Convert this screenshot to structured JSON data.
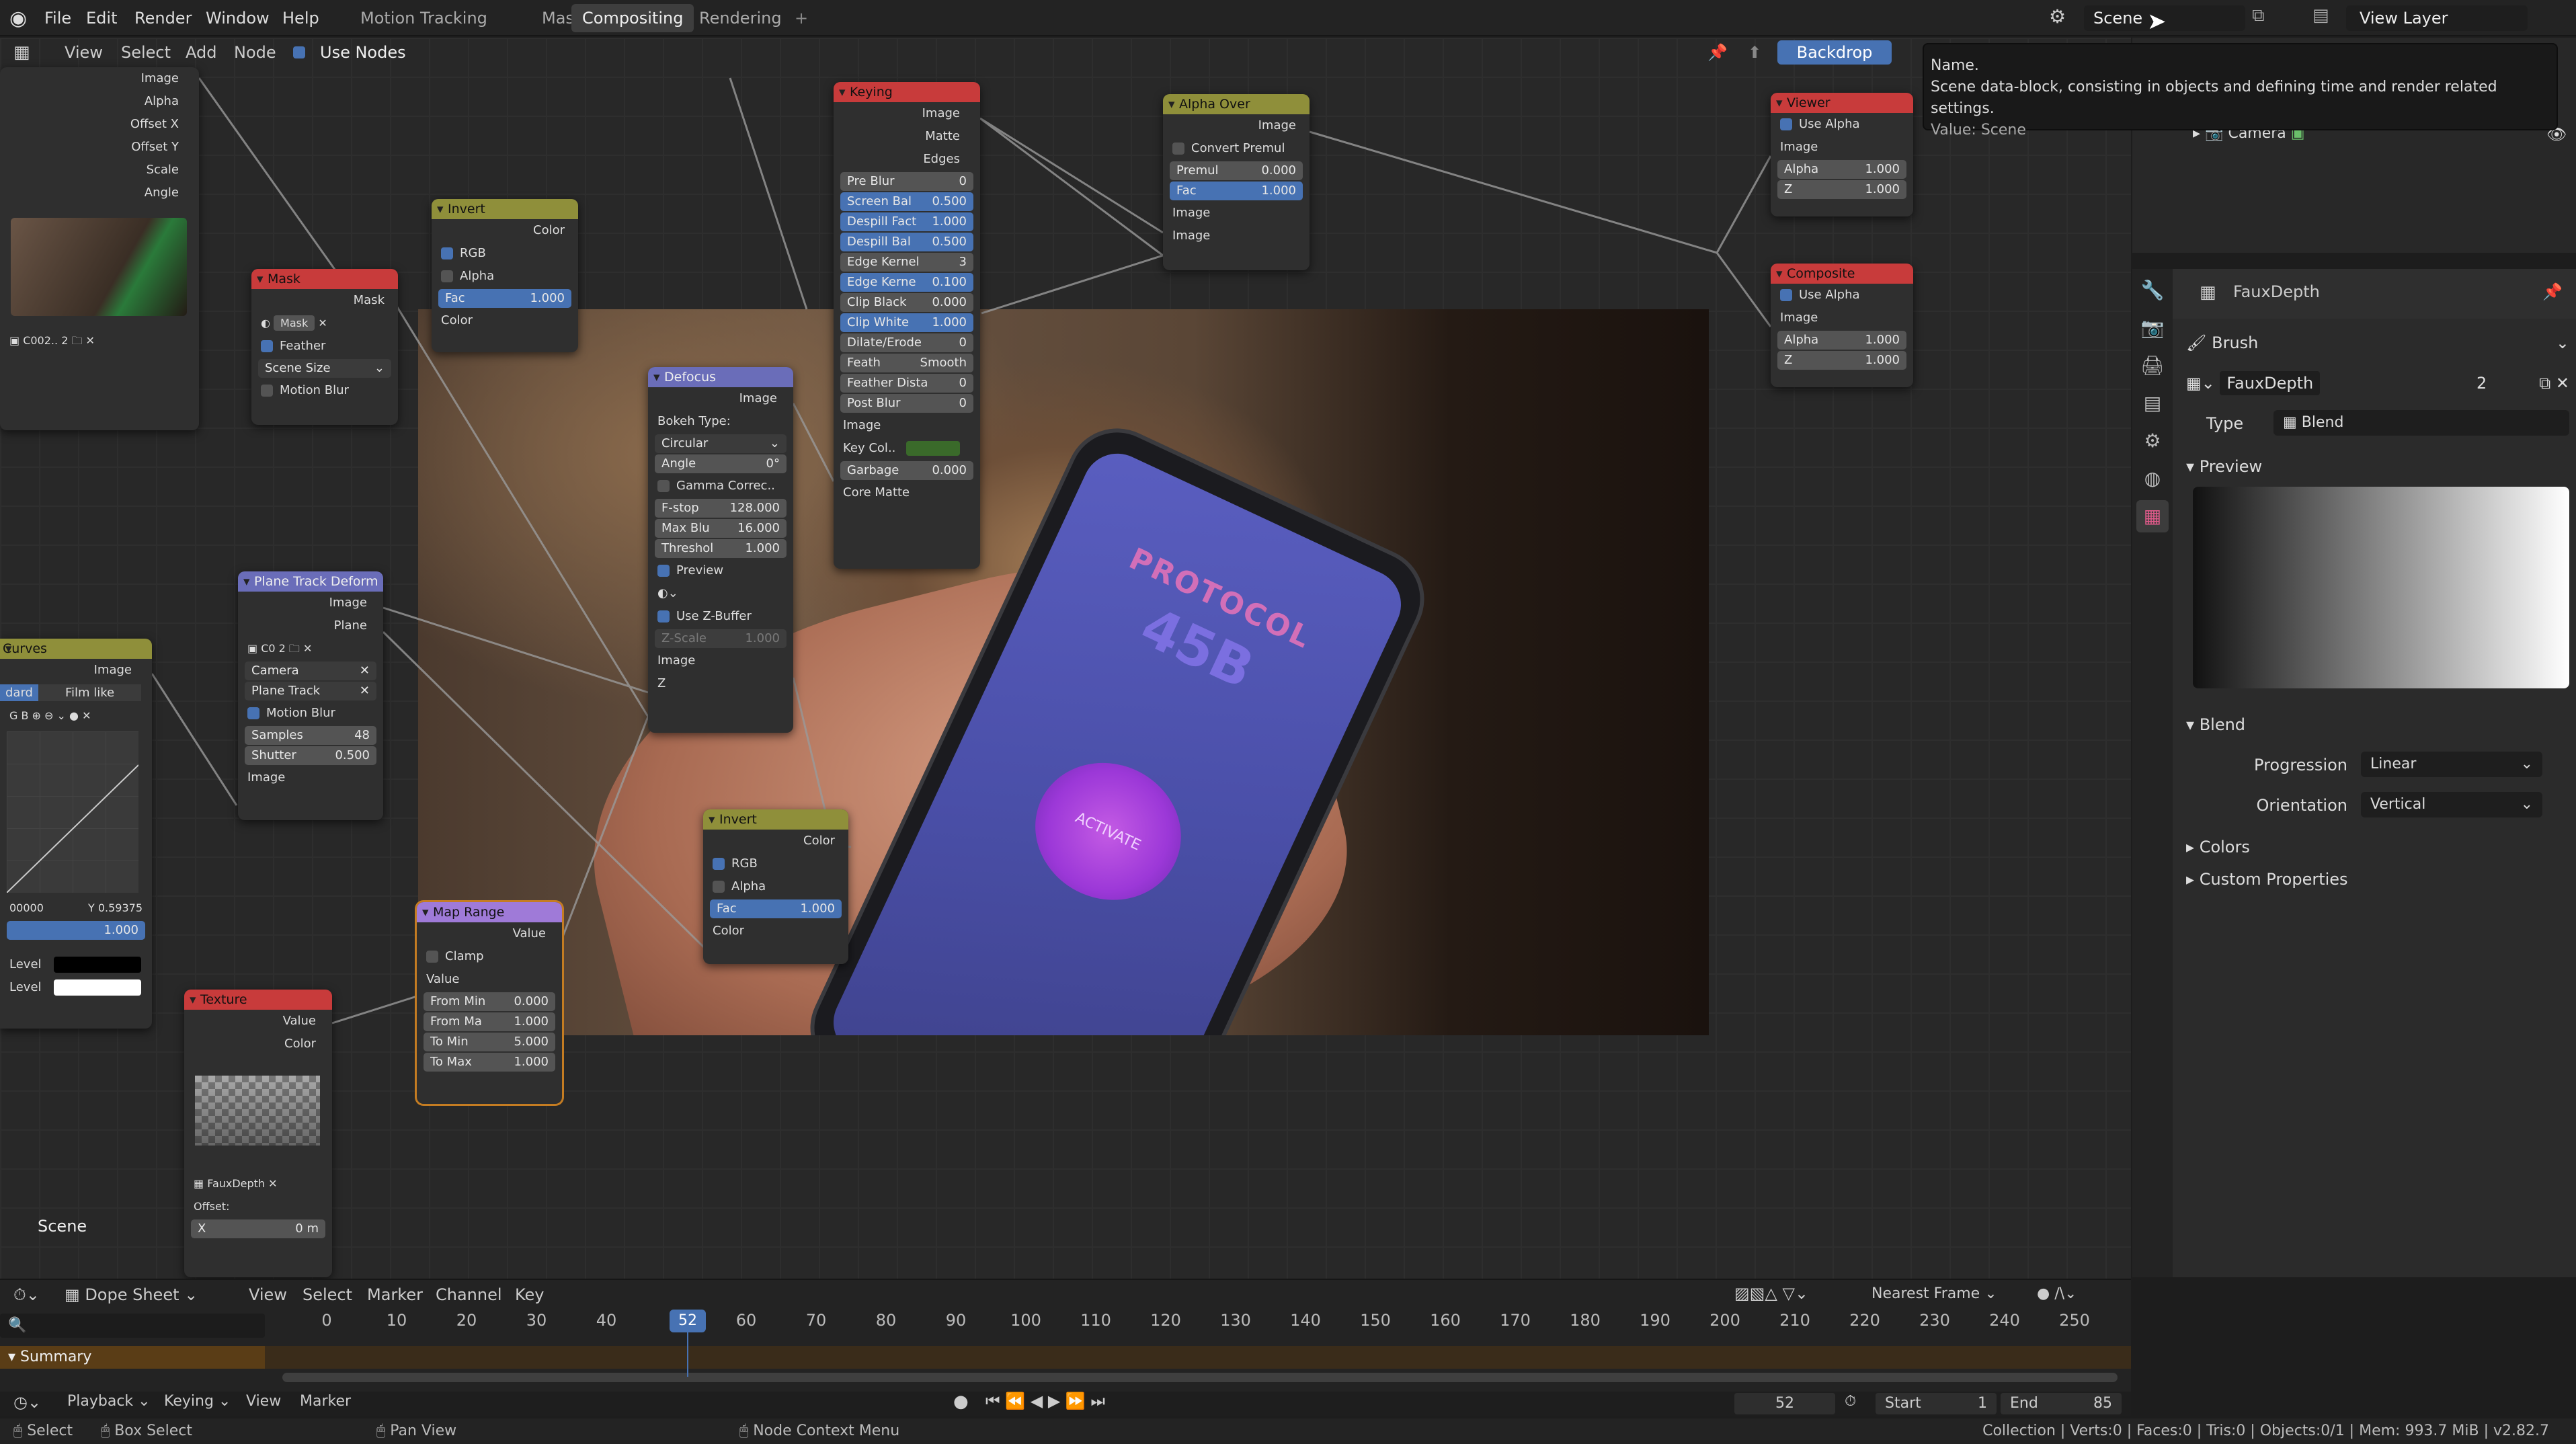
{
  "menu": {
    "items": [
      "File",
      "Edit",
      "Render",
      "Window",
      "Help"
    ],
    "workspaces": [
      "Motion Tracking",
      "Masking",
      "Compositing",
      "Rendering"
    ],
    "add": "+",
    "scene": "Scene",
    "view_layer": "View Layer"
  },
  "tooltip": {
    "title": "Name.",
    "desc": "Scene data-block, consisting in objects and defining time and render related settings.",
    "value": "Value: Scene"
  },
  "node_header": {
    "menus": [
      "View",
      "Select",
      "Add",
      "Node"
    ],
    "use_nodes": "Use Nodes",
    "backdrop": "Backdrop"
  },
  "outliner": {
    "camera": "Camera"
  },
  "nodes": {
    "image_outs": [
      "Image",
      "Alpha",
      "Offset X",
      "Offset Y",
      "Scale",
      "Angle"
    ],
    "clip_name": "C002..",
    "clip_users": "2",
    "invent1": {
      "title": "Invert",
      "out": "Color",
      "rgb": "RGB",
      "alpha": "Alpha",
      "fac_label": "Fac",
      "fac": "1.000",
      "in": "Color"
    },
    "mask": {
      "title": "Mask",
      "out": "Mask",
      "name": "Mask",
      "feather": "Feather",
      "size": "Scene Size",
      "motion_blur": "Motion Blur"
    },
    "keying": {
      "title": "Keying",
      "outs": [
        "Image",
        "Matte",
        "Edges"
      ],
      "fields": [
        [
          "Pre Blur",
          "0"
        ],
        [
          "Screen Bal",
          "0.500"
        ],
        [
          "Despill Fact",
          "1.000"
        ],
        [
          "Despill Bal",
          "0.500"
        ],
        [
          "Edge Kernel",
          "3"
        ],
        [
          "Edge Kerne",
          "0.100"
        ],
        [
          "Clip Black",
          "0.000"
        ],
        [
          "Clip White",
          "1.000"
        ],
        [
          "Dilate/Erode",
          "0"
        ],
        [
          "Feath",
          "Smooth"
        ],
        [
          "Feather Dista",
          "0"
        ],
        [
          "Post Blur",
          "0"
        ]
      ],
      "ins": [
        "Image",
        "Key Col..",
        "Garbage",
        "Core Matte"
      ],
      "garbage_val": "0.000"
    },
    "alpha_over": {
      "title": "Alpha Over",
      "out": "Image",
      "convert": "Convert Premul",
      "premul_label": "Premul",
      "premul": "0.000",
      "fac_label": "Fac",
      "fac": "1.000",
      "ins": [
        "Image",
        "Image"
      ]
    },
    "viewer": {
      "title": "Viewer",
      "use_alpha": "Use Alpha",
      "image": "Image",
      "alpha_label": "Alpha",
      "alpha": "1.000",
      "z_label": "Z",
      "z": "1.000"
    },
    "composite": {
      "title": "Composite",
      "use_alpha": "Use Alpha",
      "image": "Image",
      "alpha_label": "Alpha",
      "alpha": "1.000",
      "z_label": "Z",
      "z": "1.000"
    },
    "defocus": {
      "title": "Defocus",
      "out": "Image",
      "bokeh_label": "Bokeh Type:",
      "bokeh": "Circular",
      "angle_label": "Angle",
      "angle": "0°",
      "gamma": "Gamma Correc..",
      "fstop_label": "F-stop",
      "fstop": "128.000",
      "maxblur_label": "Max Blu",
      "maxblur": "16.000",
      "thresh_label": "Threshol",
      "thresh": "1.000",
      "preview": "Preview",
      "zbuffer": "Use Z-Buffer",
      "zscale_label": "Z-Scale",
      "zscale": "1.000",
      "ins": [
        "Image",
        "Z"
      ]
    },
    "plane_track": {
      "title": "Plane Track Deform",
      "outs": [
        "Image",
        "Plane"
      ],
      "clip": "C0",
      "users": "2",
      "camera": "Camera",
      "track": "Plane Track",
      "motion_blur": "Motion Blur",
      "samples_label": "Samples",
      "samples": "48",
      "shutter_label": "Shutter",
      "shutter": "0.500",
      "in": "Image"
    },
    "curves": {
      "title": "Curves",
      "out": "Image",
      "tab1": "dard",
      "tab2": "Film like",
      "coords": "00000",
      "y_label": "Y",
      "y": "0.59375",
      "val": "1.000",
      "level1": "Level",
      "level2": "Level"
    },
    "invert2": {
      "title": "Invert",
      "out": "Color",
      "rgb": "RGB",
      "alpha": "Alpha",
      "fac_label": "Fac",
      "fac": "1.000",
      "in": "Color"
    },
    "map_range": {
      "title": "Map Range",
      "out": "Value",
      "clamp": "Clamp",
      "value": "Value",
      "fields": [
        [
          "From Min",
          "0.000"
        ],
        [
          "From Ma",
          "1.000"
        ],
        [
          "To Min",
          "5.000"
        ],
        [
          "To Max",
          "1.000"
        ]
      ]
    },
    "texture": {
      "title": "Texture",
      "outs": [
        "Value",
        "Color"
      ],
      "name": "FauxDepth",
      "offset": "Offset:",
      "x_label": "X",
      "x": "0 m"
    }
  },
  "scene_label": "Scene",
  "properties": {
    "texture_name": "FauxDepth",
    "brush": "Brush",
    "users": "2",
    "type_label": "Type",
    "type": "Blend",
    "preview": "Preview",
    "blend": "Blend",
    "progression_label": "Progression",
    "progression": "Linear",
    "orientation_label": "Orientation",
    "orientation": "Vertical",
    "colors": "Colors",
    "custom": "Custom Properties"
  },
  "dope": {
    "mode": "Dope Sheet",
    "menus": [
      "View",
      "Select",
      "Marker",
      "Channel",
      "Key"
    ],
    "snap": "Nearest Frame",
    "summary": "Summary",
    "ticks": [
      "0",
      "10",
      "20",
      "30",
      "40",
      "52",
      "60",
      "70",
      "80",
      "90",
      "100",
      "110",
      "120",
      "130",
      "140",
      "150",
      "160",
      "170",
      "180",
      "190",
      "200",
      "210",
      "220",
      "230",
      "240",
      "250"
    ],
    "current": "52"
  },
  "timeline": {
    "menus": [
      "Playback",
      "Keying",
      "View",
      "Marker"
    ],
    "frame": "52",
    "start_label": "Start",
    "start": "1",
    "end_label": "End",
    "end": "85"
  },
  "status": {
    "select": "Select",
    "box": "Box Select",
    "pan": "Pan View",
    "ctx": "Node Context Menu",
    "stats": "Collection | Verts:0 | Faces:0 | Tris:0 | Objects:0/1 | Mem: 993.7 MiB | v2.82.7"
  }
}
